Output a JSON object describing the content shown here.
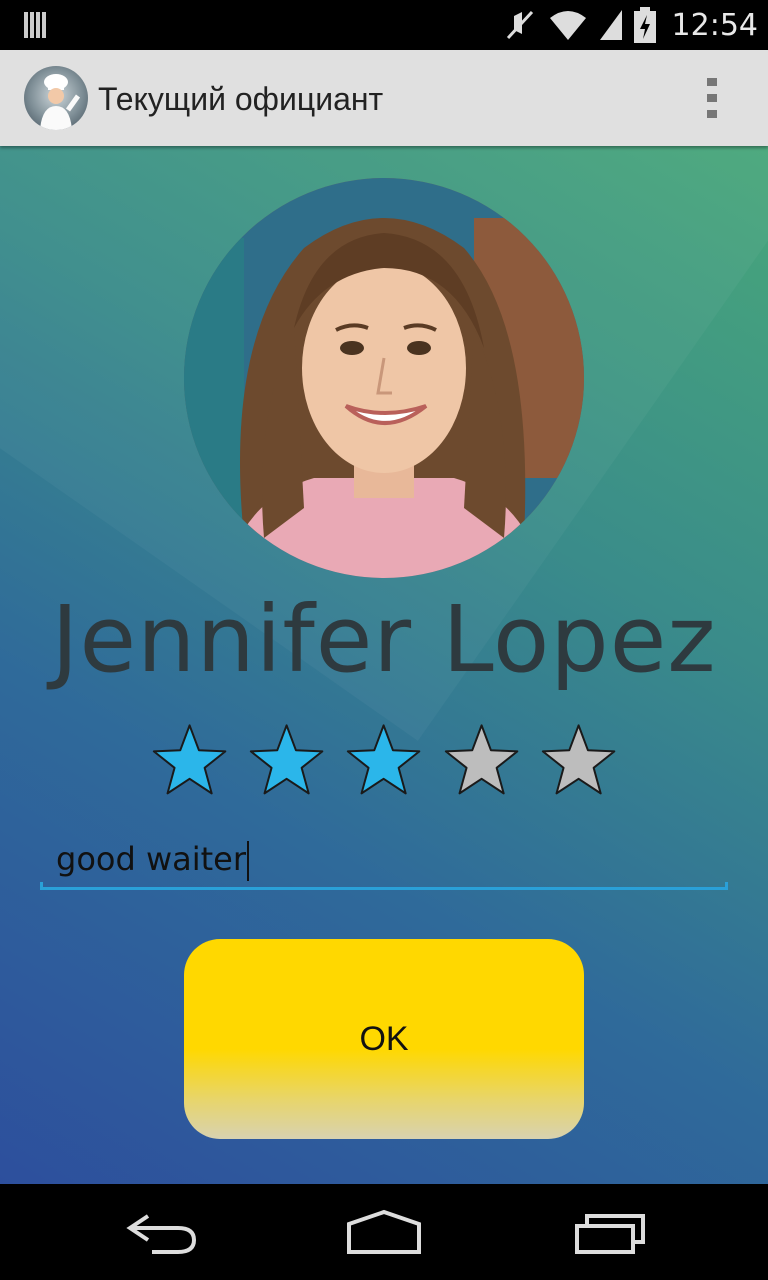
{
  "status_bar": {
    "time": "12:54",
    "icons": [
      "notification-icon",
      "mute-icon",
      "wifi-icon",
      "signal-icon",
      "battery-charging-icon"
    ]
  },
  "action_bar": {
    "title": "Текущий официант",
    "app_icon": "chef-icon",
    "menu_icon": "overflow-menu-icon"
  },
  "waiter": {
    "name": "Jennifer Lopez",
    "rating": 3,
    "max_rating": 5,
    "star_filled_color": "#2bb6ea",
    "star_empty_color": "#bdbdbd"
  },
  "comment": {
    "value": "good waiter"
  },
  "ok_button": {
    "label": "OK",
    "color": "#ffd800"
  },
  "nav_bar": {
    "icons": [
      "back-icon",
      "home-icon",
      "recent-apps-icon"
    ]
  }
}
